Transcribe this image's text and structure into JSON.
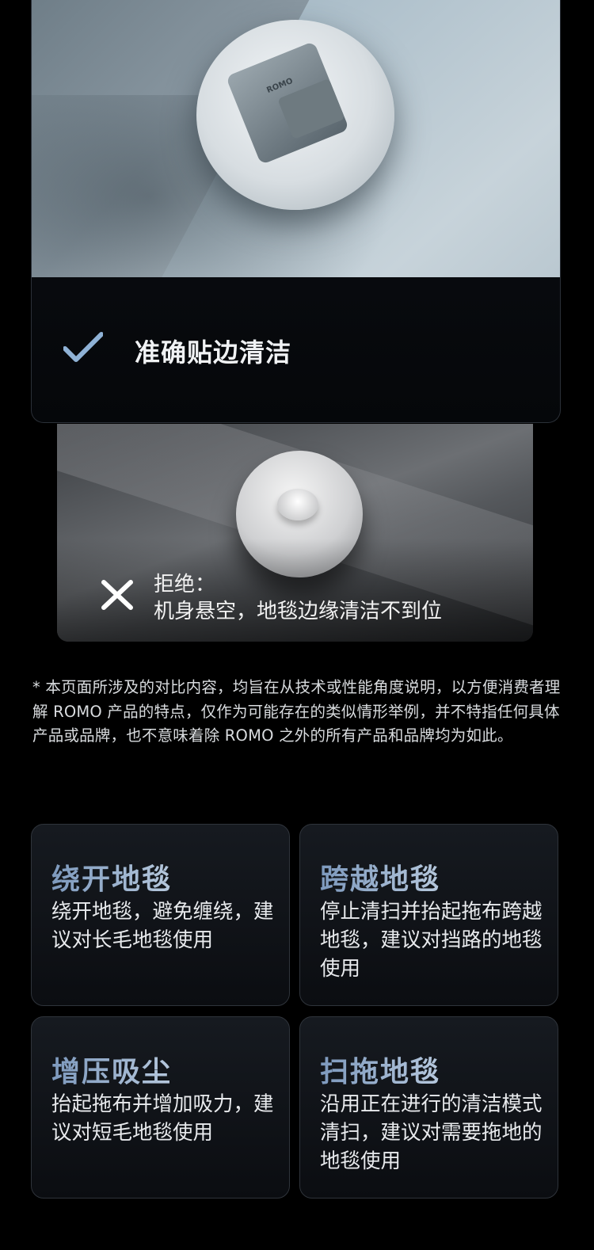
{
  "hero": {
    "caption": "准确贴边清洁",
    "robot_logo": "ROMO",
    "icon": "checkmark-icon"
  },
  "reject": {
    "title": "拒绝：",
    "description": "机身悬空，地毯边缘清洁不到位",
    "icon": "x-icon"
  },
  "disclaimer": {
    "text": "* 本页面所涉及的对比内容，均旨在从技术或性能角度说明，以方便消费者理解 ROMO 产品的特点，仅作为可能存在的类似情形举例，并不特指任何具体产品或品牌，也不意味着除 ROMO 之外的所有产品和品牌均为如此。"
  },
  "features": [
    {
      "title": "绕开地毯",
      "description": "绕开地毯，避免缠绕，建议对长毛地毯使用"
    },
    {
      "title": "跨越地毯",
      "description": "停止清扫并抬起拖布跨越地毯，建议对挡路的地毯使用"
    },
    {
      "title": "增压吸尘",
      "description": "抬起拖布并增加吸力，建议对短毛地毯使用"
    },
    {
      "title": "扫拖地毯",
      "description": "沿用正在进行的清洁模式清扫，建议对需要拖地的地毯使用"
    }
  ],
  "colors": {
    "background": "#000000",
    "feature_title_gradient": [
      "#7d99bd",
      "#b6c8dd"
    ],
    "check_icon": "#8fb2d6"
  }
}
